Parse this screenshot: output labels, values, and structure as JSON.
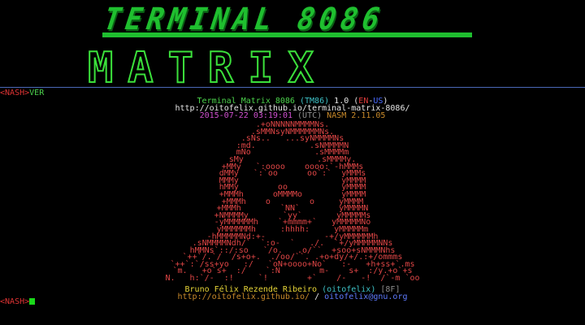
{
  "logo": {
    "top_text": "TERMINAL 8086",
    "bottom_text": "MATRIX"
  },
  "prompt1": {
    "open": "<",
    "name": "NASH",
    "close": ">",
    "command": "VER"
  },
  "info": {
    "title": "Terminal Matrix 8086",
    "abbr_open": "(",
    "abbr": "TM86",
    "abbr_close": ")",
    "version": "1.0",
    "lang_open": "(",
    "lang_en": "EN",
    "lang_dash": "-",
    "lang_us": "US",
    "lang_close": ")",
    "url": "http://oitofelix.github.io/terminal-matrix-8086/",
    "date": "2015-07-22",
    "time": "03:19:01",
    "tz": "(UTC)",
    "assembler": "NASM 2.11.05"
  },
  "art_lines": [
    ".+oNNNNNMMMMNs.",
    ".sMMNsyNMMMMMMNs.",
    ".sNs..   ...syNMMMMNs",
    ":md.           .sNMMMMN",
    "mNo             .sMMMMm",
    "sMy               .sMMMMy.",
    "+MMy   `:oooo    oooo:`-hMMMs",
    "dMMy   `:`oo      oo`:`  yMMMs",
    "MMMy                     yMMMM",
    "hMMy        oo           yMMMM",
    "+MMMh      oMMMMo        yMMMM",
    "+MMMh    o        o     yMMMM",
    "+MMMh        `NN`        yMMMMN",
    "+NMMMMy       `yy`       yMMMMMs",
    "-yMMMMMMh    `+mmmm+`   yMMMMMNo",
    "yMMMMMMh     :hhhh:     yMMMMMm",
    "-hMMMMMNd:+-            -+/yMMMMMMh",
    ".sNMMMMNdh/`  `:o-  `   ./.  `+/yMMMMMNNs",
    "hMMNs`::/:so   `/o.   .o/``  +soo+sNMMMNhs",
    "`++`/.`/  /s+o+.  ./oo/``. .+o+dy/+/.:+/ommms",
    "`++`:`/ss+yo   :/   `oN+oooo+No`   :-   +h+ss+`.ms",
    "`m.   +o`s+  :/    `:N        m-    s+  :/y.+o`+s",
    "N.   h:`/-  :!     `!        +`    /-   -!  /`-m `oo"
  ],
  "credits": {
    "name": "Bruno Félix Rezende Ribeiro",
    "handle_open": "(",
    "handle": "oitofelix",
    "handle_close": ")",
    "page": "[8F]",
    "site": "http://oitofelix.github.io/",
    "sep": "/",
    "email": "oitofelix@gnu.org"
  },
  "prompt2": {
    "open": "<",
    "name": "NASH",
    "close": ">"
  },
  "colors": {
    "logo_green": "#1fbf2f",
    "prompt_red": "#dd3333",
    "command_green": "#4cd24c",
    "divider_blue": "#4a68b8",
    "art_red": "#e04646"
  }
}
